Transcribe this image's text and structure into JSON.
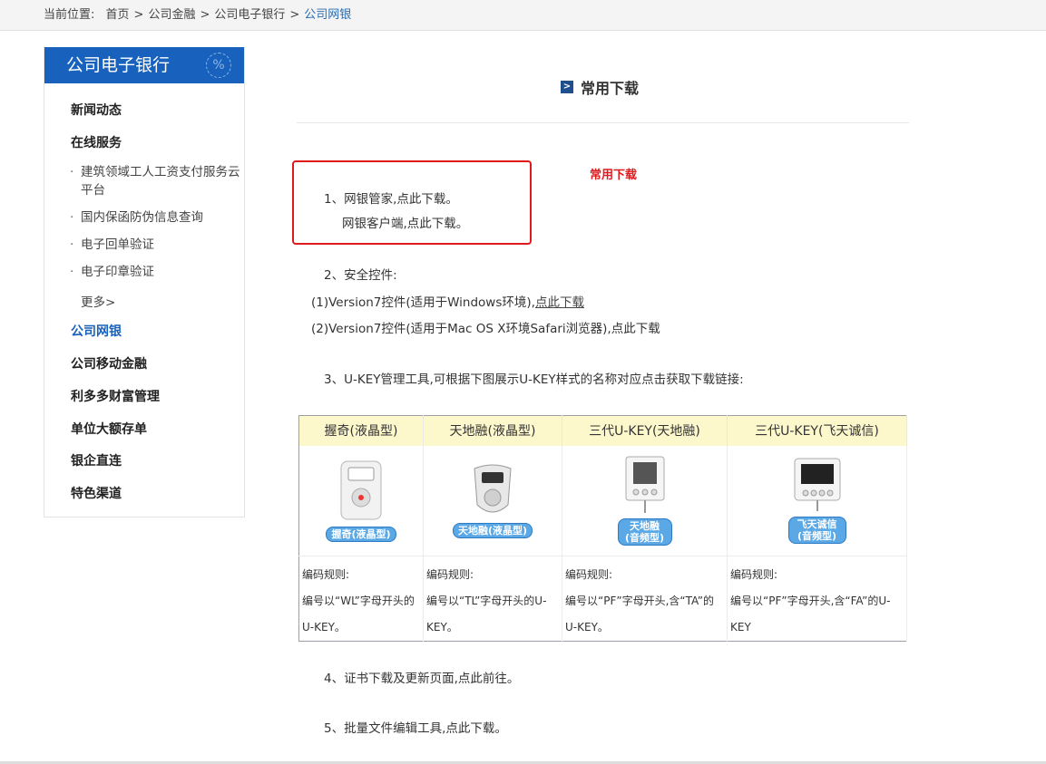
{
  "breadcrumb": {
    "label": "当前位置:",
    "items": [
      "首页",
      "公司金融",
      "公司电子银行"
    ],
    "current": "公司网银",
    "separator": ">"
  },
  "sidebar": {
    "title": "公司电子银行",
    "badge": "%",
    "items": [
      {
        "label": "新闻动态"
      },
      {
        "label": "在线服务"
      }
    ],
    "sub_items": [
      {
        "dot": "·",
        "label": "建筑领域工人工资支付服务云平台"
      },
      {
        "dot": "·",
        "label": "国内保函防伪信息查询"
      },
      {
        "dot": "·",
        "label": "电子回单验证"
      },
      {
        "dot": "·",
        "label": "电子印章验证"
      }
    ],
    "more": "更多>",
    "items2": [
      {
        "label": "公司网银"
      },
      {
        "label": "公司移动金融"
      },
      {
        "label": "利多多财富管理"
      },
      {
        "label": "单位大额存单"
      },
      {
        "label": "银企直连"
      },
      {
        "label": "特色渠道"
      }
    ]
  },
  "main": {
    "title": "常用下载",
    "title_icon": ">",
    "red_title": "常用下载",
    "line1": "1、网银管家,点此下载。",
    "line1b": "网银客户端,点此下载。",
    "line2": "2、安全控件:",
    "line3_prefix": "(1)Version7控件(适用于Windows环境),",
    "line3_link": "点此下载",
    "line4": "(2)Version7控件(适用于Mac OS X环境Safari浏览器),点此下载",
    "line5": "3、U-KEY管理工具,可根据下图展示U-KEY样式的名称对应点击获取下载链接:",
    "line6": "4、证书下载及更新页面,点此前往。",
    "line7": "5、批量文件编辑工具,点此下载。"
  },
  "ukey_table": {
    "headers": [
      "握奇(液晶型)",
      "天地融(液晶型)",
      "三代U-KEY(天地融)",
      "三代U-KEY(飞天诚信)"
    ],
    "image_labels": [
      "握奇(液晶型)",
      "天地融(液晶型)",
      "天地融(音频型)",
      "飞天诚信(音频型)"
    ],
    "rule_label": "编码规则:",
    "rules": [
      "编号以“WL”字母开头的U-KEY。",
      "编号以“TL”字母开头的U-KEY。",
      "编号以“PF”字母开头,含“TA”的U-KEY。",
      "编号以“PF”字母开头,含“FA”的U-KEY"
    ]
  },
  "colors": {
    "accent": "#1862bd",
    "highlight_red": "#e0191d",
    "table_header": "#fdf7cc"
  }
}
